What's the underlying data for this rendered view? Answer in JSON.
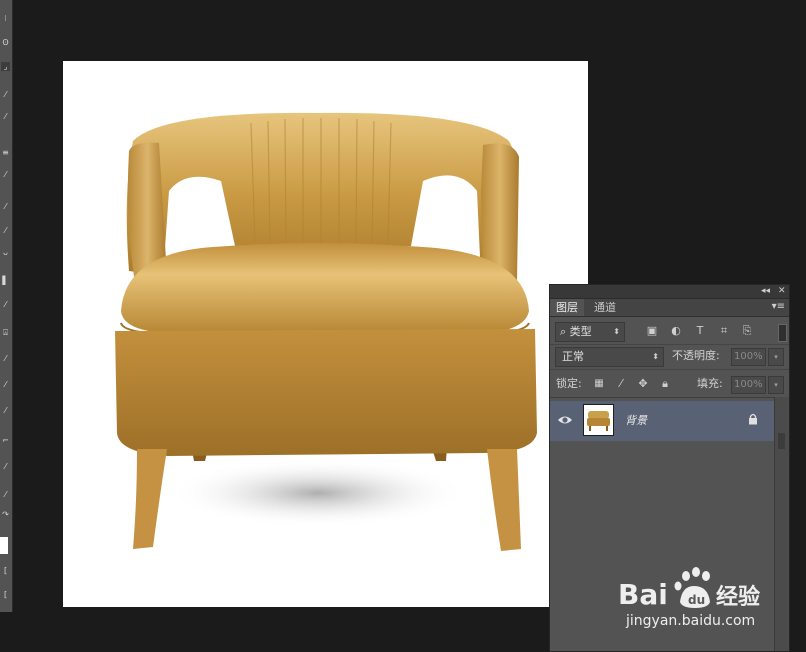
{
  "layers_panel": {
    "tabs": [
      {
        "label": "图层"
      },
      {
        "label": "通道"
      }
    ],
    "filter": {
      "kind_label": "类型"
    },
    "blend_mode": "正常",
    "opacity_label": "不透明度:",
    "opacity_value": "100%",
    "lock_label": "锁定:",
    "fill_label": "填充:",
    "fill_value": "100%",
    "layers": [
      {
        "name": "背景",
        "visible": true,
        "locked": true
      }
    ]
  },
  "watermark": {
    "logo_text": "Bai du 经验",
    "url": "jingyan.baidu.com"
  },
  "colors": {
    "app_bg": "#1b1b1b",
    "panel_bg": "#535353",
    "selected_layer": "#596175",
    "chair_gold": "#c9a04a"
  }
}
